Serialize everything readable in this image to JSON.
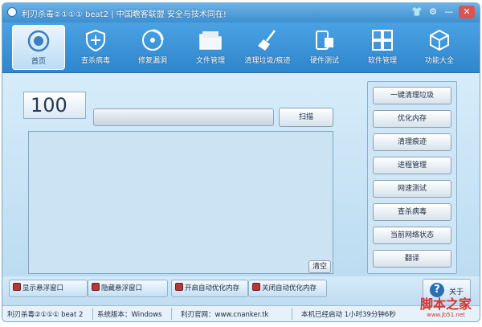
{
  "window": {
    "title": "利刃杀毒②①①① beat2 | 中国瞻客联盟 安全与技术同在!",
    "controls": {
      "skin": "👕",
      "settings": "⚙",
      "minimize": "—",
      "close": "✕"
    }
  },
  "toolbar": {
    "items": [
      {
        "label": "首页",
        "icon": "home-shield-icon",
        "active": true
      },
      {
        "label": "查杀病毒",
        "icon": "virus-scan-icon",
        "active": false
      },
      {
        "label": "修复漏洞",
        "icon": "patch-disc-icon",
        "active": false
      },
      {
        "label": "文件管理",
        "icon": "folder-icon",
        "active": false
      },
      {
        "label": "清理垃圾/痕迹",
        "icon": "broom-icon",
        "active": false
      },
      {
        "label": "硬件测试",
        "icon": "hardware-icon",
        "active": false
      },
      {
        "label": "软件管理",
        "icon": "grid-apps-icon",
        "active": false
      },
      {
        "label": "功能大全",
        "icon": "cube-icon",
        "active": false
      }
    ]
  },
  "main": {
    "score": "100",
    "progress_percent": 0,
    "scan_label": "扫描",
    "clear_label": "清空"
  },
  "side_panel": {
    "buttons": [
      "一键清理垃圾",
      "优化内存",
      "清理痕迹",
      "进程管理",
      "网速测试",
      "查杀病毒",
      "当前网络状态",
      "翻译"
    ]
  },
  "bottom_options": [
    "显示悬浮窗口",
    "隐藏悬浮窗口",
    "开启自动优化内存",
    "关闭自动优化内存"
  ],
  "about_label": "关于",
  "status": {
    "app": "利刃杀毒②①①① beat 2",
    "system": "系统版本：Windows",
    "website": "利刃官网：www.cnanker.tk",
    "uptime": "本机已经启动 1小时39分钟6秒"
  },
  "watermark": {
    "main": "脚本之家",
    "sub": "www.jb51.net"
  },
  "colors": {
    "toolbar": "#3d8fd0",
    "panel": "#cfe6f7",
    "accent": "#d9312b"
  }
}
